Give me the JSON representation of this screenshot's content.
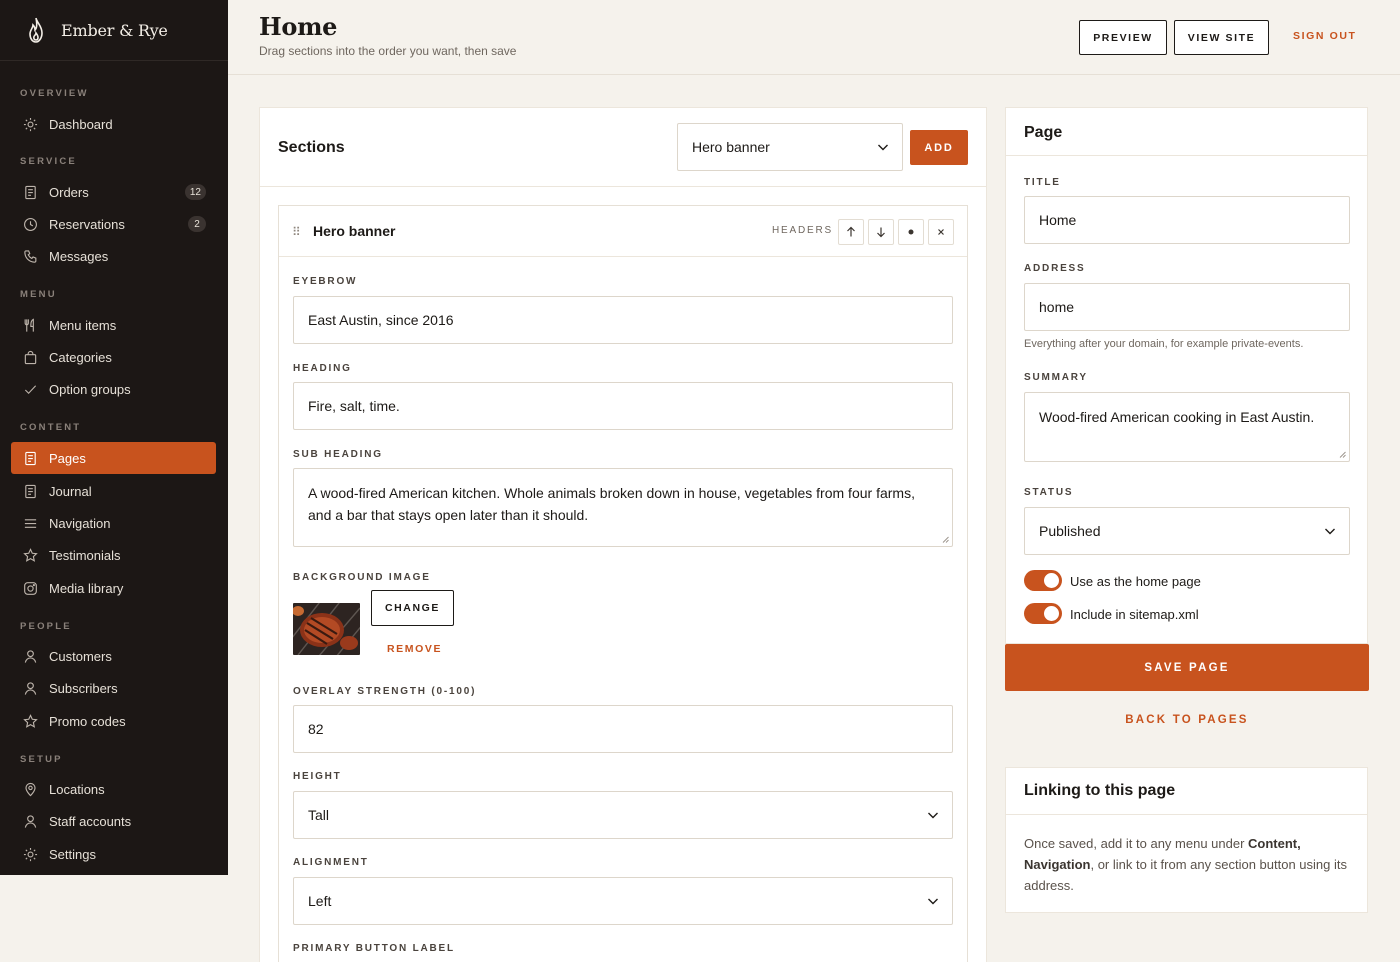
{
  "brand": {
    "name": "Ember & Rye"
  },
  "sidebar": {
    "groups": [
      {
        "label": "OVERVIEW"
      },
      {
        "label": "SERVICE"
      },
      {
        "label": "MENU"
      },
      {
        "label": "CONTENT"
      },
      {
        "label": "PEOPLE"
      },
      {
        "label": "SETUP"
      }
    ],
    "items": [
      {
        "label": "Dashboard",
        "icon": "sun-icon"
      },
      {
        "label": "Orders",
        "icon": "receipt-icon",
        "badge": "12"
      },
      {
        "label": "Reservations",
        "icon": "clock-icon",
        "badge": "2"
      },
      {
        "label": "Messages",
        "icon": "phone-icon"
      },
      {
        "label": "Menu items",
        "icon": "utensils-icon"
      },
      {
        "label": "Categories",
        "icon": "bag-icon"
      },
      {
        "label": "Option groups",
        "icon": "check-icon"
      },
      {
        "label": "Pages",
        "icon": "page-icon"
      },
      {
        "label": "Journal",
        "icon": "page-icon"
      },
      {
        "label": "Navigation",
        "icon": "menu-lines-icon"
      },
      {
        "label": "Testimonials",
        "icon": "star-icon"
      },
      {
        "label": "Media library",
        "icon": "instagram-icon"
      },
      {
        "label": "Customers",
        "icon": "user-icon"
      },
      {
        "label": "Subscribers",
        "icon": "user-icon"
      },
      {
        "label": "Promo codes",
        "icon": "star-icon"
      },
      {
        "label": "Locations",
        "icon": "pin-icon"
      },
      {
        "label": "Staff accounts",
        "icon": "user-icon"
      },
      {
        "label": "Settings",
        "icon": "sun-icon"
      }
    ],
    "active": "Pages"
  },
  "header": {
    "title": "Home",
    "subtitle": "Drag sections into the order you want, then save",
    "preview_label": "PREVIEW",
    "view_site_label": "VIEW SITE",
    "sign_out_label": "SIGN OUT"
  },
  "sections": {
    "title": "Sections",
    "picker_value": "Hero banner",
    "add_label": "ADD",
    "block": {
      "name": "Hero banner",
      "tag": "HEADERS",
      "fields": {
        "eyebrow_label": "EYEBROW",
        "eyebrow_value": "East Austin, since 2016",
        "heading_label": "HEADING",
        "heading_value": "Fire, salt, time.",
        "subheading_label": "SUB HEADING",
        "subheading_value": "A wood-fired American kitchen. Whole animals broken down in house, vegetables from four farms, and a bar that stays open later than it should.",
        "bg_label": "BACKGROUND IMAGE",
        "change_label": "CHANGE",
        "remove_label": "REMOVE",
        "overlay_label": "OVERLAY STRENGTH (0-100)",
        "overlay_value": "82",
        "height_label": "HEIGHT",
        "height_value": "Tall",
        "alignment_label": "ALIGNMENT",
        "alignment_value": "Left",
        "primary_label": "PRIMARY BUTTON LABEL"
      }
    }
  },
  "page_panel": {
    "title": "Page",
    "title_label": "TITLE",
    "title_value": "Home",
    "address_label": "ADDRESS",
    "address_value": "home",
    "address_hint": "Everything after your domain, for example private-events.",
    "summary_label": "SUMMARY",
    "summary_value": "Wood-fired American cooking in East Austin.",
    "status_label": "STATUS",
    "status_value": "Published",
    "toggle_home_label": "Use as the home page",
    "toggle_home_on": true,
    "toggle_sitemap_label": "Include in sitemap.xml",
    "toggle_sitemap_on": true,
    "save_label": "SAVE PAGE",
    "back_label": "BACK TO PAGES"
  },
  "linking": {
    "title": "Linking to this page",
    "text_1": "Once saved, add it to any menu under ",
    "bold_1": "Content, Navigation",
    "text_2": ", or link to it from any section button using its address."
  },
  "colors": {
    "accent": "#c8531e",
    "sidebar_bg": "#1c1715",
    "page_bg": "#f5f2ec"
  }
}
